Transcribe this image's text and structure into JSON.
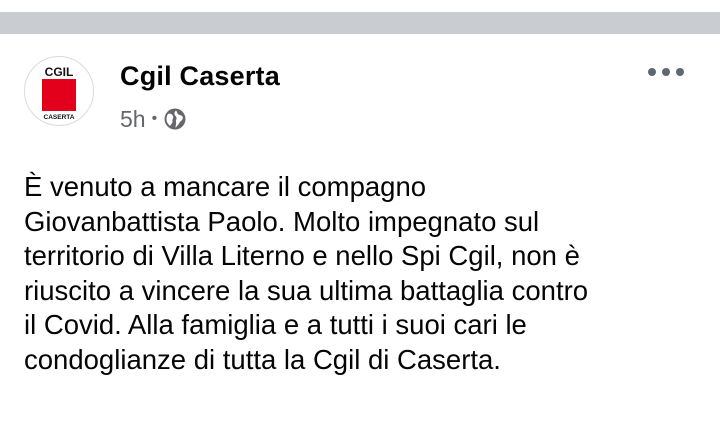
{
  "post": {
    "page_name": "Cgil Caserta",
    "timestamp": "5h",
    "separator": "•",
    "audience_icon": "globe-icon",
    "more_icon": "more-options-icon",
    "avatar": {
      "logo_text_top": "CGIL",
      "logo_text_bottom": "CASERTA",
      "logo_color": "#e3001b"
    },
    "body_lines": [
      "È venuto a mancare il compagno",
      "Giovanbattista Paolo. Molto impegnato sul",
      "territorio di Villa Literno e nello Spi Cgil, non è",
      "riuscito a vincere la sua ultima battaglia contro",
      "il Covid. Alla famiglia e a tutti i suoi cari le",
      "condoglianze di tutta la Cgil di Caserta."
    ]
  },
  "colors": {
    "separator_bar": "#c9ccd1",
    "primary_text": "#050505",
    "secondary_text": "#65676b"
  }
}
